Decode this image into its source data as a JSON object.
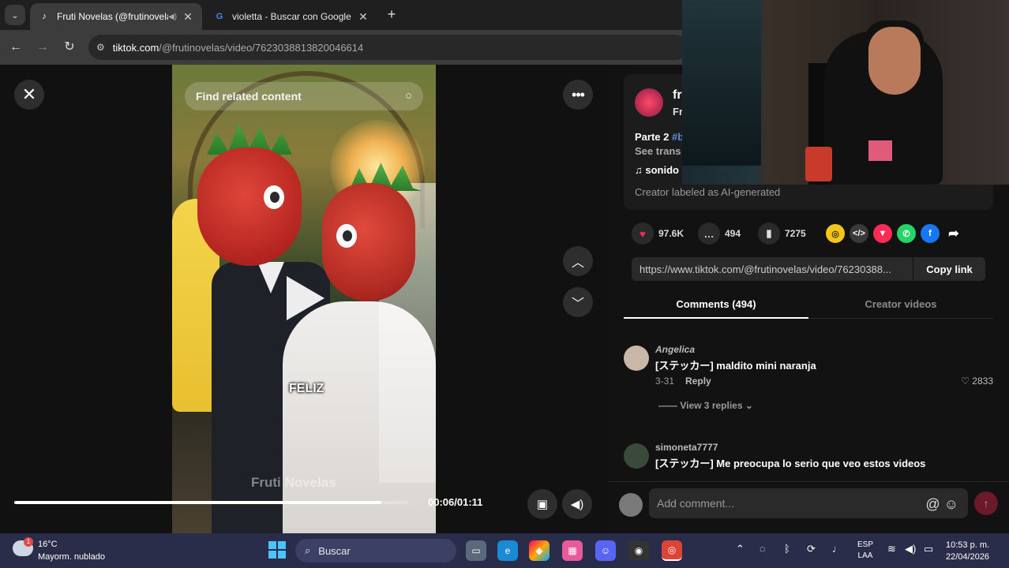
{
  "browser": {
    "tabs": [
      {
        "title": "Fruti Novelas (@frutinovela",
        "active": true
      },
      {
        "title": "violetta - Buscar con Google",
        "active": false
      }
    ],
    "url_host": "tiktok.com",
    "url_path": "/@frutinovelas/video/7623038813820046614"
  },
  "video": {
    "search_placeholder": "Find related content",
    "caption": "FELIZ",
    "watermark": "Fruti Novelas",
    "time": "00:06/01:11",
    "progress": 0.93
  },
  "panel": {
    "creator_name": "fr",
    "creator_sub": "Fr",
    "description_prefix": "Parte 2 ",
    "description_tag": "#b",
    "see_translation": "See trans",
    "sound": "sonido",
    "ai_label": "Creator labeled as AI-generated",
    "likes": "97.6K",
    "comments_count": "494",
    "saves": "7275",
    "link_url": "https://www.tiktok.com/@frutinovelas/video/76230388...",
    "copy_link": "Copy link",
    "tab_comments": "Comments (494)",
    "tab_creator": "Creator videos",
    "comments": [
      {
        "user": "Angelica",
        "text": "[ステッカー] maldito mini naranja",
        "date": "3-31",
        "reply": "Reply",
        "likes": "2833",
        "view_replies": "View 3 replies"
      },
      {
        "user": "simoneta7777",
        "text": "[ステッカー] Me preocupa lo serio que veo estos videos"
      }
    ],
    "add_comment_placeholder": "Add comment..."
  },
  "taskbar": {
    "temp": "16°C",
    "condition": "Mayorm. nublado",
    "weather_badge": "1",
    "search_label": "Buscar",
    "lang_1": "ESP",
    "lang_2": "LAA",
    "time": "10:53 p. m.",
    "date": "22/04/2026"
  }
}
